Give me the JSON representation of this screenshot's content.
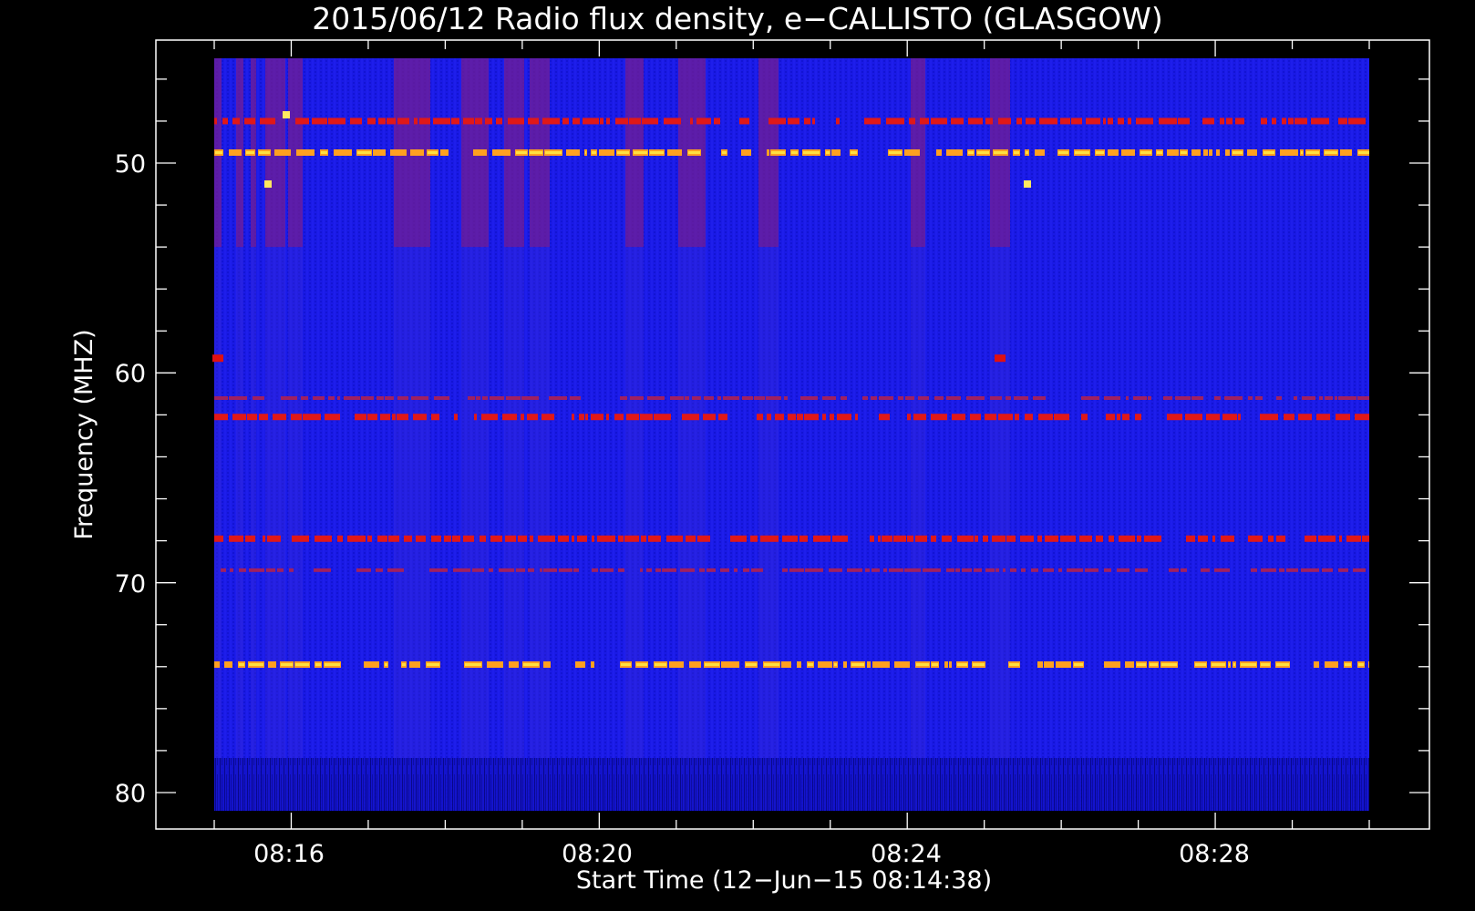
{
  "chart_data": {
    "type": "heatmap",
    "title": "2015/06/12  Radio flux density, e−CALLISTO (GLASGOW)",
    "xlabel": "Start Time (12−Jun−15 08:14:38)",
    "ylabel": "Frequency (MHZ)",
    "x_ticks": [
      "08:16",
      "08:20",
      "08:24",
      "08:28"
    ],
    "y_ticks": [
      "50",
      "60",
      "70",
      "80"
    ],
    "y_axis_inverted": true,
    "colormap": "blue-red-yellow",
    "background_color": "#1a1ae0",
    "steady_bands_mhz": [
      {
        "freq": 48.0,
        "intensity": "medium",
        "pattern": "dashed"
      },
      {
        "freq": 49.5,
        "intensity": "high",
        "pattern": "dashed"
      },
      {
        "freq": 61.2,
        "intensity": "low",
        "pattern": "dashed"
      },
      {
        "freq": 62.1,
        "intensity": "medium",
        "pattern": "dashed"
      },
      {
        "freq": 67.9,
        "intensity": "medium",
        "pattern": "dashed"
      },
      {
        "freq": 69.4,
        "intensity": "low",
        "pattern": "dashed"
      },
      {
        "freq": 73.9,
        "intensity": "high",
        "pattern": "dashed"
      }
    ]
  }
}
